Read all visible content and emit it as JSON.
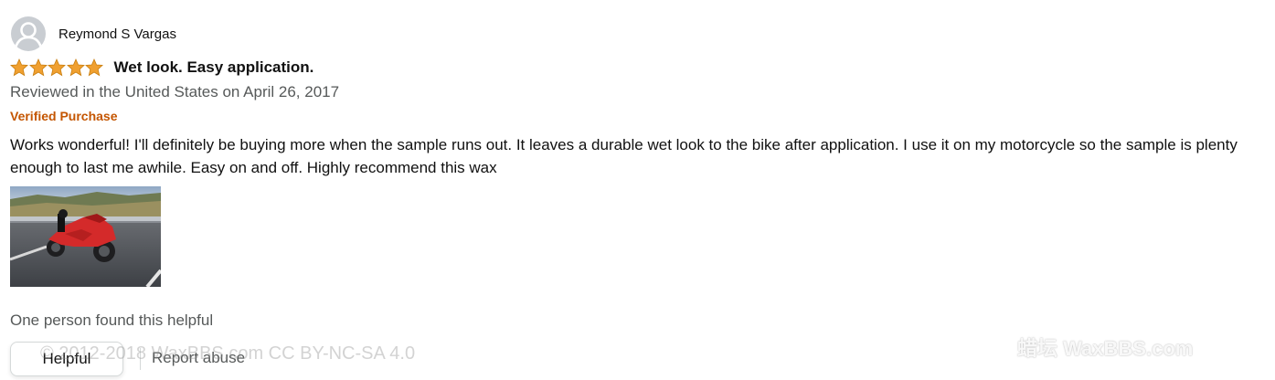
{
  "reviewer": {
    "name": "Reymond S Vargas",
    "avatar_icon": "default-avatar-icon"
  },
  "review": {
    "rating": 5,
    "rating_max": 5,
    "star_color": "#f0a030",
    "title": "Wet look. Easy application.",
    "date": "Reviewed in the United States on April 26, 2017",
    "verified": "Verified Purchase",
    "body": "Works wonderful! I'll definitely be buying more when the sample runs out. It leaves a durable wet look to the bike after application. I use it on my motorcycle so the sample is plenty enough to last me awhile. Easy on and off. Highly recommend this wax"
  },
  "photo": {
    "subject": "red motorcycle parked by guardrail"
  },
  "footer": {
    "helpful_count_text": "One person found this helpful",
    "helpful_label": "Helpful",
    "report_label": "Report abuse"
  },
  "watermarks": {
    "left": "© 2012-2018 WaxBBS.com CC BY-NC-SA 4.0",
    "right": "蜡坛 WaxBBS.com"
  },
  "colors": {
    "text_primary": "#111111",
    "text_secondary": "#565959",
    "verified": "#c45500",
    "button_border": "#d5d9d9"
  }
}
